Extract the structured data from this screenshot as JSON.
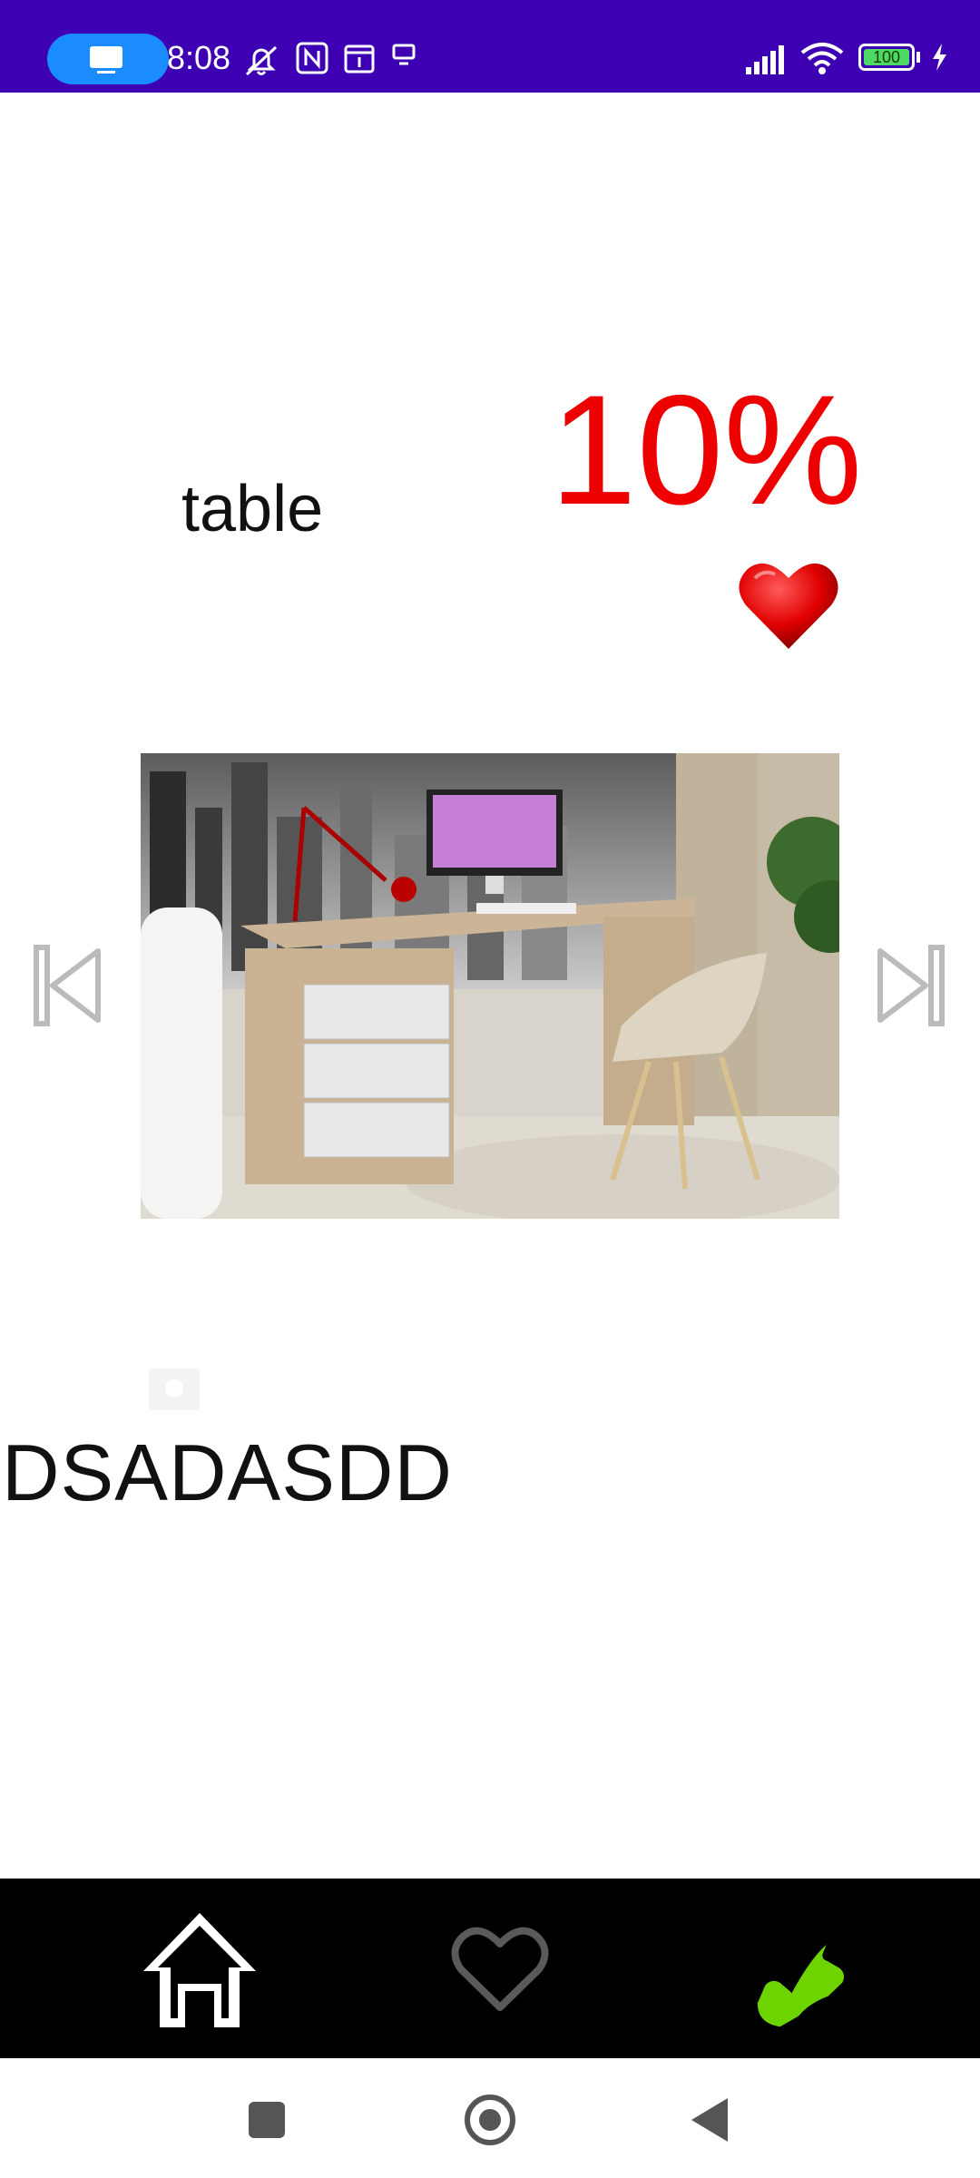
{
  "status_bar": {
    "time": "8:08",
    "battery": "100",
    "icons": [
      "cast-icon",
      "mute-notifications-icon",
      "nfc-icon",
      "calendar-icon",
      "screen-icon",
      "signal-icon",
      "wifi-icon",
      "battery-icon",
      "charging-icon"
    ]
  },
  "product": {
    "name": "table",
    "discount": "10%",
    "description": "DSADASDD"
  },
  "bottom_nav": {
    "items": [
      "home-icon",
      "favorites-icon",
      "call-icon"
    ]
  },
  "colors": {
    "status_bar": "#3d00b2",
    "discount": "#ef0000",
    "nav_bar": "#000000",
    "call": "#6ed400"
  }
}
